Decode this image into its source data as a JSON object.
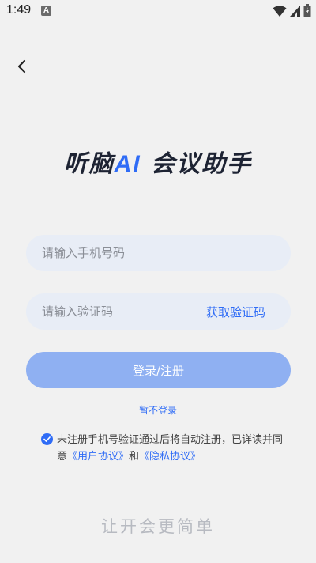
{
  "status_bar": {
    "time": "1:49",
    "app_icon_letter": "A",
    "wifi_icon": "wifi-icon",
    "signal_icon": "signal-icon",
    "battery_icon": "battery-icon"
  },
  "nav": {
    "back_icon": "chevron-left-icon"
  },
  "title": {
    "prefix": "听脑",
    "accent": "AI",
    "suffix": " 会议助手"
  },
  "form": {
    "phone_placeholder": "请输入手机号码",
    "phone_value": "",
    "code_placeholder": "请输入验证码",
    "code_value": "",
    "get_code_label": "获取验证码",
    "login_label": "登录/注册",
    "skip_label": "暂不登录"
  },
  "agreement": {
    "checked": true,
    "text_1": "未注册手机号验证通过后将自动注册，已详读并同意",
    "user_agreement": "《用户协议》",
    "and": "和",
    "privacy_policy": "《隐私协议》"
  },
  "slogan": "让开会更简单",
  "colors": {
    "accent": "#2f6cf6",
    "button_disabled": "#8fb0f2",
    "field_bg": "#e8edf6",
    "page_bg": "#f1f1f1",
    "title": "#1d2333"
  }
}
